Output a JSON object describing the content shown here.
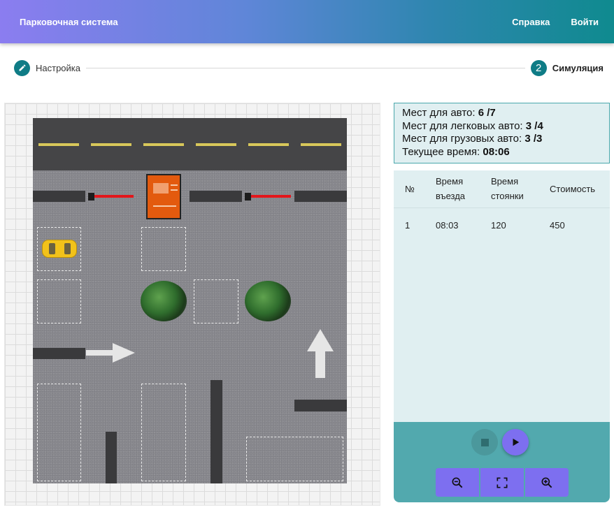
{
  "header": {
    "title": "Парковочная система",
    "help_label": "Справка",
    "login_label": "Войти"
  },
  "stepper": {
    "step1_label": "Настройка",
    "step2_number": "2",
    "step2_label": "Симуляция"
  },
  "stats": {
    "total_label": "Мест для авто:",
    "total_value": "6 /7",
    "cars_label": "Мест для легковых авто:",
    "cars_value": "3 /4",
    "trucks_label": "Мест для грузовых авто:",
    "trucks_value": "3 /3",
    "time_label": "Текущее время:",
    "time_value": "08:06"
  },
  "table": {
    "headers": [
      "№",
      "Время въезда",
      "Время стоянки",
      "Стоимость"
    ],
    "rows": [
      [
        "1",
        "08:03",
        "120",
        "450"
      ]
    ]
  },
  "colors": {
    "accent": "#7d6ff0",
    "teal": "#0f7c86",
    "panel_bg": "#e0eff1",
    "controls_bg": "#52a9ae",
    "kiosk": "#e35a0e",
    "barrier": "#e3161b",
    "car": "#f2c21a"
  },
  "icons": {
    "step1": "pencil-icon",
    "stop": "stop-icon",
    "play": "play-icon",
    "zoom_out": "zoom-out-icon",
    "fit": "fullscreen-icon",
    "zoom_in": "zoom-in-icon"
  }
}
